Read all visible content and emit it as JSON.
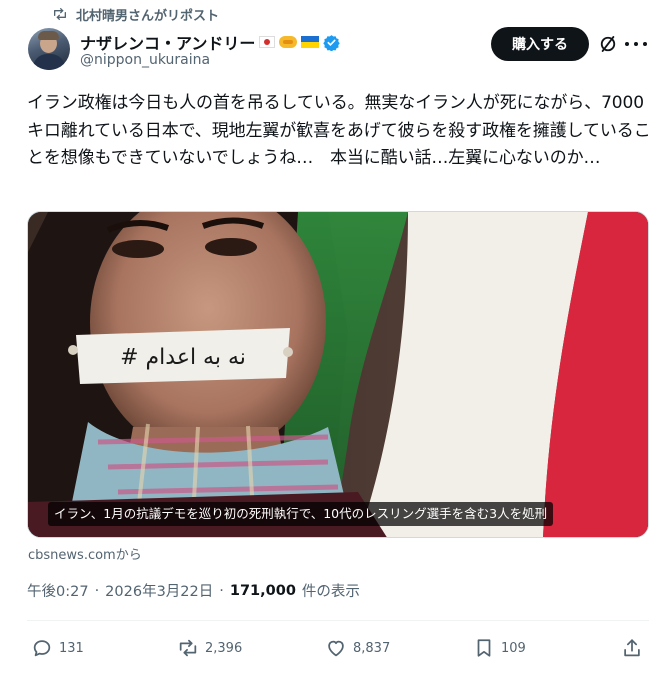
{
  "repost": {
    "text": "北村晴男さんがリポスト",
    "icon": "repost-icon"
  },
  "author": {
    "display_name": "ナザレンコ・アンドリー",
    "handle": "@nippon_ukuraina",
    "badges": [
      "japan-flag-icon",
      "handshake-icon",
      "ukraine-flag-icon",
      "verified-badge-icon"
    ],
    "verified_color": "#1d9bf0"
  },
  "header_actions": {
    "buy_label": "購入する",
    "grok_icon": "grok-icon",
    "more_icon": "more-icon"
  },
  "tweet": {
    "text": "イラン政権は今日も人の首を吊るしている。無実なイラン人が死にながら、7000キロ離れている日本で、現地左翼が歓喜をあげて彼らを殺す政権を擁護していることを想像もできていないでしょうね…　本当に酷い話…左翼に心ないのか…"
  },
  "media": {
    "caption": "イラン、1月の抗議デモを巡り初の死刑執行で、10代のレスリング選手を含む3人を処刑",
    "tape_text": "# نه به اعدام",
    "source": "cbsnews.comから"
  },
  "meta": {
    "time": "午後0:27",
    "sep1": "·",
    "date": "2026年3月22日",
    "sep2": "·",
    "views_count": "171,000",
    "views_label": "件の表示"
  },
  "actions": {
    "replies": "131",
    "reposts": "2,396",
    "likes": "8,837",
    "bookmarks": "109"
  },
  "colors": {
    "text": "#0f1419",
    "secondary": "#536471",
    "accent": "#1d9bf0",
    "button_bg": "#0f1419"
  }
}
